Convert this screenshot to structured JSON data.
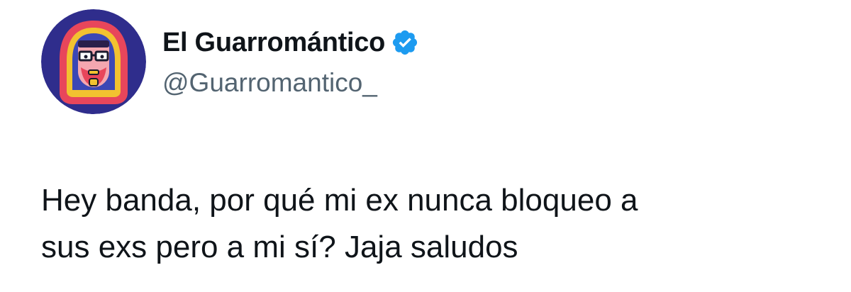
{
  "profile": {
    "display_name": "El Guarromántico",
    "handle": "@Guarromantico_",
    "verified": true,
    "avatar_icon": "bearded-man-avatar-icon",
    "verified_icon": "verified-badge-icon",
    "accent_color": "#1d9bf0"
  },
  "tweet": {
    "text_lines": [
      "Hey banda, por qué mi ex nunca bloqueo a",
      "sus exs pero a mi sí? Jaja saludos"
    ]
  },
  "colors": {
    "text_primary": "#0f1419",
    "text_secondary": "#536471",
    "background": "#ffffff",
    "verified": "#1d9bf0"
  }
}
